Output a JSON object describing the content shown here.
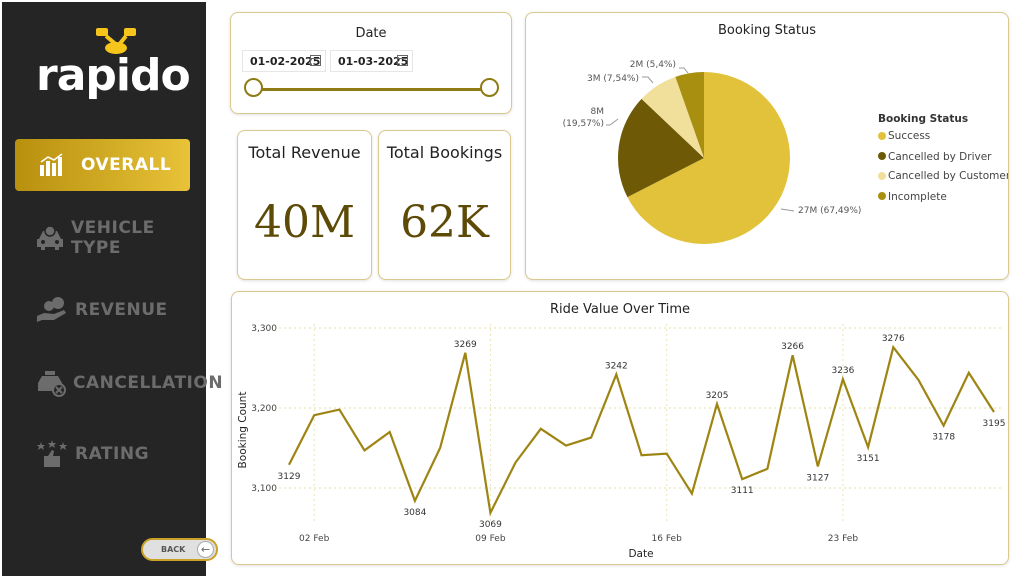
{
  "app": {
    "brand": "rapido"
  },
  "nav": {
    "items": [
      {
        "label": "OVERALL",
        "icon": "bar-chart-icon",
        "active": true
      },
      {
        "label": "VEHICLE TYPE",
        "icon": "car-icon",
        "active": false
      },
      {
        "label": "REVENUE",
        "icon": "money-hand-icon",
        "active": false
      },
      {
        "label": "CANCELLATION",
        "icon": "taxi-cancel-icon",
        "active": false
      },
      {
        "label": "RATING",
        "icon": "stars-thumb-icon",
        "active": false
      }
    ],
    "back_label": "BACK"
  },
  "date_filter": {
    "title": "Date",
    "start": "01-02-2025",
    "end": "01-03-2025"
  },
  "kpis": {
    "revenue": {
      "title": "Total Revenue",
      "value": "40M"
    },
    "bookings": {
      "title": "Total Bookings",
      "value": "62K"
    }
  },
  "colors": {
    "accent": "#e8c238",
    "success": "#e2c23a",
    "cancelled_driver": "#6e5a06",
    "cancelled_customer": "#f0e09b",
    "incomplete": "#a98f10",
    "line": "#9e8412",
    "sidebar_bg": "#252525"
  },
  "chart_data": [
    {
      "type": "pie",
      "title": "Booking Status",
      "legend_title": "Booking Status",
      "legend_position": "right",
      "slices": [
        {
          "name": "Success",
          "value": 27,
          "label": "27M (67,49%)",
          "pct": 67.49,
          "color": "#e2c23a"
        },
        {
          "name": "Cancelled by Driver",
          "value": 8,
          "label": "8M (19,57%)",
          "pct": 19.57,
          "color": "#6e5a06"
        },
        {
          "name": "Cancelled by Customer",
          "value": 3,
          "label": "3M (7,54%)",
          "pct": 7.54,
          "color": "#f0e09b"
        },
        {
          "name": "Incomplete",
          "value": 2,
          "label": "2M (5,4%)",
          "pct": 5.4,
          "color": "#a98f10"
        }
      ],
      "pie_labels": {
        "success": "27M (67,49%)",
        "driver_a": "8M",
        "driver_b": "(19,57%)",
        "customer": "3M (7,54%)",
        "incomplete": "2M (5,4%)"
      }
    },
    {
      "type": "line",
      "title": "Ride Value Over Time",
      "xlabel": "Date",
      "ylabel": "Booking Count",
      "ylim": [
        3075,
        3300
      ],
      "yticks": [
        "3,100",
        "3,200",
        "3,300"
      ],
      "xticks": [
        "02 Feb",
        "09 Feb",
        "16 Feb",
        "23 Feb"
      ],
      "grid": true,
      "x": [
        "01 Feb",
        "02 Feb",
        "03 Feb",
        "04 Feb",
        "05 Feb",
        "06 Feb",
        "07 Feb",
        "08 Feb",
        "09 Feb",
        "10 Feb",
        "11 Feb",
        "12 Feb",
        "13 Feb",
        "14 Feb",
        "15 Feb",
        "16 Feb",
        "17 Feb",
        "18 Feb",
        "19 Feb",
        "20 Feb",
        "21 Feb",
        "22 Feb",
        "23 Feb",
        "24 Feb",
        "25 Feb",
        "26 Feb",
        "27 Feb",
        "28 Feb",
        "01 Mar"
      ],
      "values": [
        3129,
        3191,
        3198,
        3147,
        3170,
        3084,
        3150,
        3269,
        3069,
        3132,
        3174,
        3153,
        3163,
        3242,
        3141,
        3143,
        3093,
        3205,
        3111,
        3124,
        3266,
        3127,
        3236,
        3151,
        3276,
        3235,
        3178,
        3244,
        3195
      ],
      "labeled": {
        "0": "3129",
        "5": "3084",
        "7": "3269",
        "8": "3069",
        "13": "3242",
        "17": "3205",
        "18": "3111",
        "20": "3266",
        "21": "3127",
        "22": "3236",
        "23": "3151",
        "24": "3276",
        "26": "3178",
        "28": "3195"
      }
    }
  ]
}
